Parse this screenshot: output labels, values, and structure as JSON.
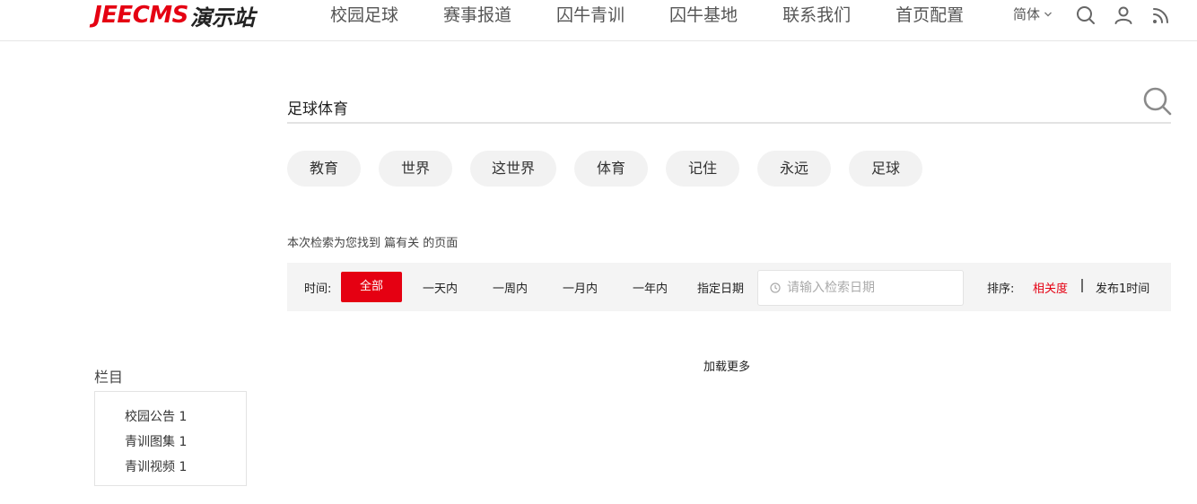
{
  "header": {
    "logo_en": "JEECMS",
    "logo_cn": "演示站",
    "nav": [
      "校园足球",
      "赛事报道",
      "囚牛青训",
      "囚牛基地",
      "联系我们",
      "首页配置"
    ],
    "lang": "简体",
    "icons": [
      "search-icon",
      "user-icon",
      "rss-icon"
    ]
  },
  "search": {
    "value": "足球体育",
    "button_icon": "search-icon"
  },
  "tags": [
    "教育",
    "世界",
    "这世界",
    "体育",
    "记住",
    "永远",
    "足球"
  ],
  "result_text": "本次检索为您找到 篇有关 的页面",
  "filter": {
    "time_label": "时间:",
    "options": [
      "全部",
      "一天内",
      "一周内",
      "一月内",
      "一年内",
      "指定日期"
    ],
    "active": "全部",
    "date_placeholder": "请输入检索日期",
    "sort_label": "排序:",
    "sort_relevance": "相关度",
    "sort_time": "发布1时间"
  },
  "load_more": "加载更多",
  "sidebar": {
    "title": "栏目",
    "items": [
      "校园公告 1",
      "青训图集 1",
      "青训视频 1"
    ]
  },
  "colors": {
    "accent": "#e50012",
    "tag_bg": "#f2f2f2",
    "filter_bg": "#f4f4f4"
  }
}
